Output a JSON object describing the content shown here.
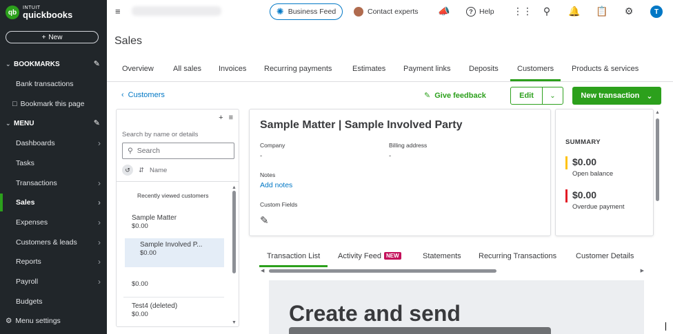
{
  "sidebar": {
    "logo_intuit": "INTUIT",
    "logo_product": "quickbooks",
    "logo_mark": "qb",
    "new_button": "New",
    "bookmarks_header": "BOOKMARKS",
    "bookmarks": [
      {
        "label": "Bank transactions"
      },
      {
        "label": "Bookmark this page"
      }
    ],
    "menu_header": "MENU",
    "menu_items": [
      {
        "label": "Dashboards"
      },
      {
        "label": "Tasks"
      },
      {
        "label": "Transactions"
      },
      {
        "label": "Sales"
      },
      {
        "label": "Expenses"
      },
      {
        "label": "Customers & leads"
      },
      {
        "label": "Reports"
      },
      {
        "label": "Payroll"
      },
      {
        "label": "Budgets"
      }
    ],
    "menu_settings": "Menu settings",
    "accent_color": "#2ca01c"
  },
  "topbar": {
    "business_feed": "Business Feed",
    "contact_experts": "Contact experts",
    "help": "Help",
    "user_initial": "T"
  },
  "page": {
    "title": "Sales",
    "tabs": [
      {
        "label": "Overview"
      },
      {
        "label": "All sales"
      },
      {
        "label": "Invoices"
      },
      {
        "label": "Recurring payments"
      },
      {
        "label": "Estimates"
      },
      {
        "label": "Payment links"
      },
      {
        "label": "Deposits"
      },
      {
        "label": "Customers"
      },
      {
        "label": "Products & services"
      }
    ],
    "active_tab": "Customers"
  },
  "actions": {
    "back_link": "Customers",
    "give_feedback": "Give feedback",
    "edit": "Edit",
    "new_transaction": "New transaction"
  },
  "customer_list": {
    "search_label": "Search by name or details",
    "search_placeholder": "Search",
    "sort_label": "Name",
    "recent_label": "Recently viewed customers",
    "customers": [
      {
        "name": "Sample Matter",
        "amount": "$0.00"
      },
      {
        "name": "Sample Involved P...",
        "amount": "$0.00"
      },
      {
        "name": "",
        "amount": "$0.00"
      },
      {
        "name": "Test4 (deleted)",
        "amount": "$0.00"
      }
    ]
  },
  "details": {
    "title": "Sample Matter | Sample Involved Party",
    "company_label": "Company",
    "company_value": "-",
    "billing_label": "Billing address",
    "billing_value": "-",
    "notes_label": "Notes",
    "add_notes": "Add notes",
    "custom_fields_label": "Custom Fields"
  },
  "summary": {
    "header": "SUMMARY",
    "open_balance": {
      "amount": "$0.00",
      "label": "Open balance",
      "color": "#ffc20e"
    },
    "overdue": {
      "amount": "$0.00",
      "label": "Overdue payment",
      "color": "#e21b25"
    }
  },
  "detail_tabs": {
    "tabs": [
      {
        "label": "Transaction List"
      },
      {
        "label": "Activity Feed"
      },
      {
        "label": "Statements"
      },
      {
        "label": "Recurring Transactions"
      },
      {
        "label": "Customer Details"
      }
    ],
    "new_badge": "NEW"
  },
  "promo": {
    "headline": "Create and send"
  }
}
